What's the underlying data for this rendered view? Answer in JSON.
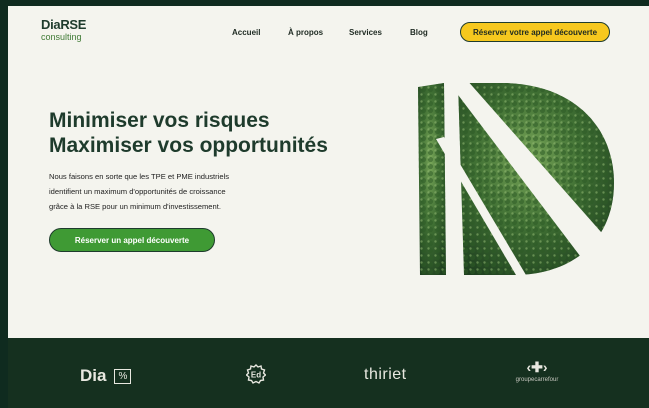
{
  "header": {
    "logo": {
      "brand": "DiaRSE",
      "subtitle": "consulting"
    },
    "nav": [
      "Accueil",
      "À propos",
      "Services",
      "Blog"
    ],
    "cta": "Réserver votre appel découverte"
  },
  "hero": {
    "title_line1": "Minimiser vos risques",
    "title_line2": "Maximiser vos opportunités",
    "text_line1": "Nous faisons en sorte que les TPE et PME industriels",
    "text_line2": "identifient un maximum d'opportunités de croissance",
    "text_line3": "grâce à la RSE pour un minimum d'investissement.",
    "cta": "Réserver un appel découverte"
  },
  "partners": {
    "dia": {
      "name": "Dia",
      "badge": "%"
    },
    "ed": "Ed",
    "thiriet": "thiriet",
    "carrefour": "groupecarrefour"
  },
  "colors": {
    "dark_green": "#1e3b2c",
    "brand_green": "#3f9a34",
    "yellow": "#f6c81e",
    "background": "#f4f4ee",
    "band": "#15301f"
  }
}
